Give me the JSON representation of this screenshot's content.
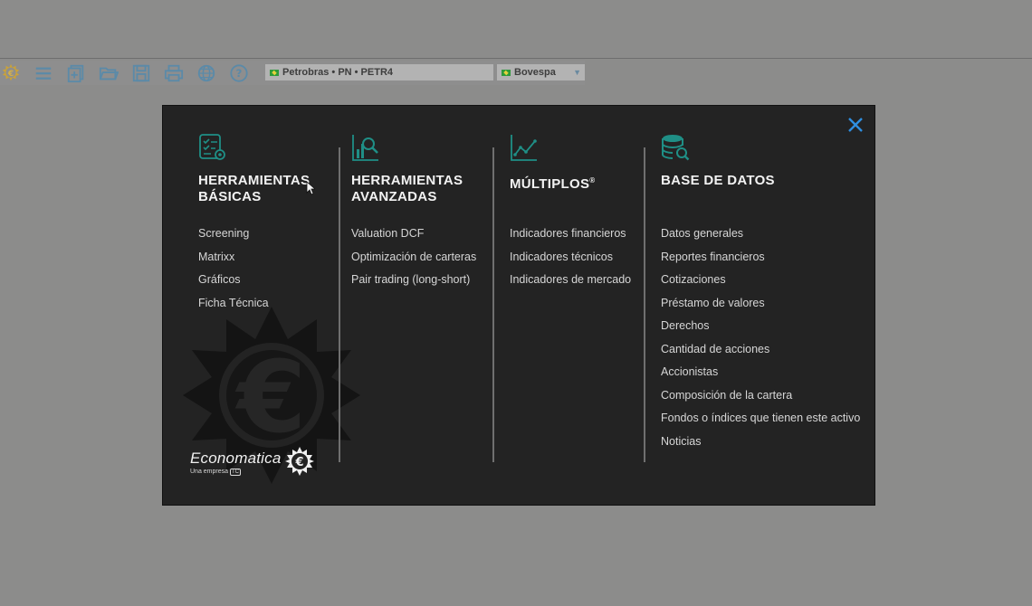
{
  "toolbar": {
    "buttons": [
      {
        "icon": "economatica-logo-icon"
      },
      {
        "icon": "menu-icon"
      },
      {
        "icon": "new-document-icon"
      },
      {
        "icon": "open-folder-icon"
      },
      {
        "icon": "save-icon"
      },
      {
        "icon": "print-icon"
      },
      {
        "icon": "globe-icon"
      },
      {
        "icon": "help-icon"
      }
    ],
    "asset_selector": {
      "value": "Petrobras • PN • PETR4"
    },
    "market_selector": {
      "value": "Bovespa"
    }
  },
  "dialog": {
    "columns": [
      {
        "icon": "checklist-gear-icon",
        "title": "HERRAMIENTAS\nBÁSICAS",
        "items": [
          "Screening",
          "Matrixx",
          "Gráficos",
          "Ficha Técnica"
        ]
      },
      {
        "icon": "chart-magnifier-icon",
        "title": "HERRAMIENTAS\nAVANZADAS",
        "items": [
          "Valuation DCF",
          "Optimización de carteras",
          "Pair trading (long-short)"
        ]
      },
      {
        "icon": "line-chart-icon",
        "title": "MÚLTIPLOS",
        "title_mark": "®",
        "items": [
          "Indicadores financieros",
          "Indicadores técnicos",
          "Indicadores de mercado"
        ]
      },
      {
        "icon": "database-search-icon",
        "title": "BASE DE DATOS",
        "items": [
          "Datos generales",
          "Reportes financieros",
          "Cotizaciones",
          "Préstamo de valores",
          "Derechos",
          "Cantidad de acciones",
          "Accionistas",
          "Composición de la cartera",
          "Fondos o índices que tienen este activo",
          "Noticias"
        ]
      }
    ],
    "brand": {
      "name": "Economatica",
      "tagline": "Una empresa",
      "tagline_badge": "TC"
    }
  },
  "colors": {
    "accent_teal": "#1f8f86",
    "close_blue": "#2f8fe0",
    "dialog_bg": "#232323",
    "toolbar_icon": "#5b8aa8"
  }
}
